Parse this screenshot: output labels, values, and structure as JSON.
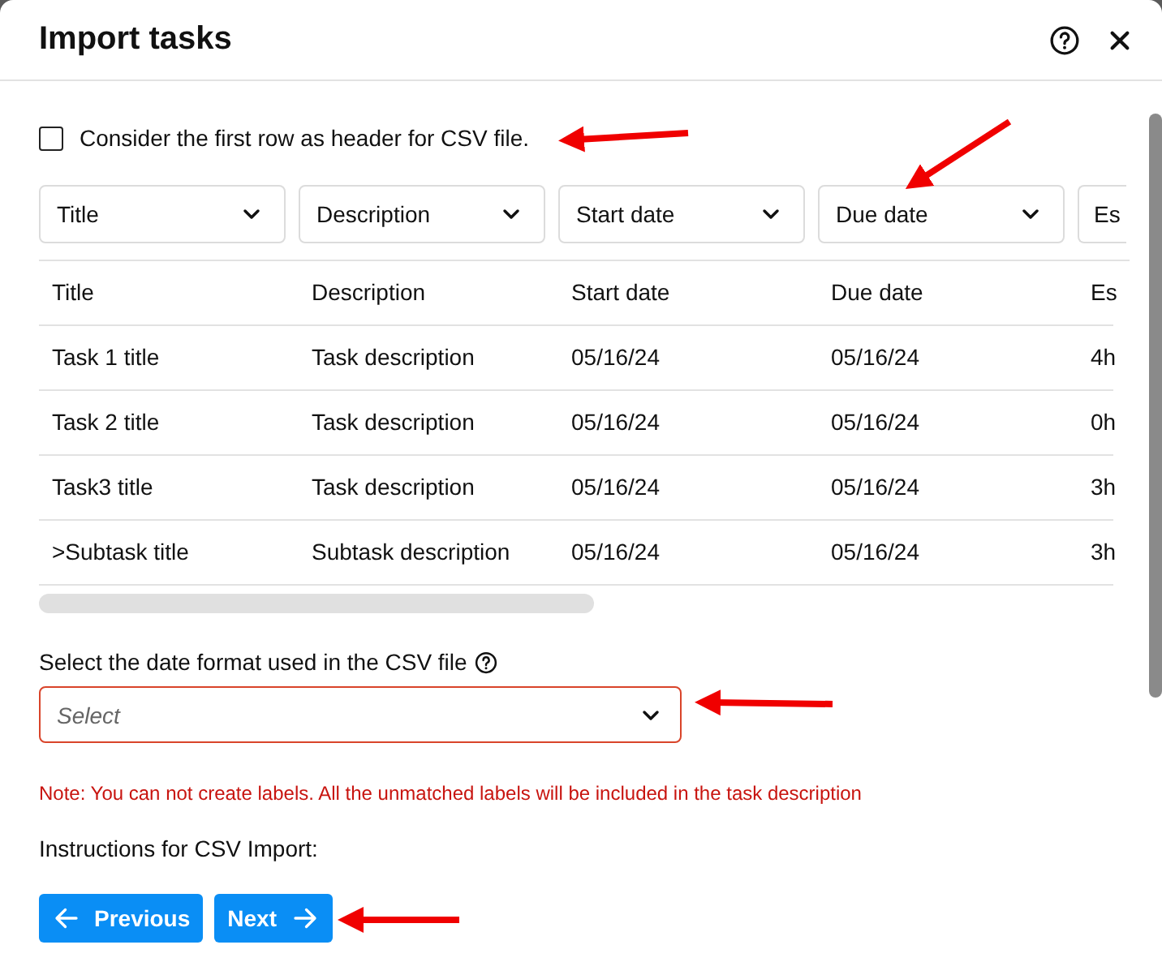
{
  "dialog": {
    "title": "Import tasks"
  },
  "header_checkbox": {
    "label": "Consider the first row as header for CSV file.",
    "checked": false
  },
  "column_mappings": [
    {
      "value": "Title"
    },
    {
      "value": "Description"
    },
    {
      "value": "Start date"
    },
    {
      "value": "Due date"
    },
    {
      "value": "Es"
    }
  ],
  "table": {
    "columns": [
      "Title",
      "Description",
      "Start date",
      "Due date",
      "Es"
    ],
    "rows": [
      [
        "Task 1 title",
        "Task description",
        "05/16/24",
        "05/16/24",
        "4h"
      ],
      [
        "Task 2 title",
        "Task description",
        "05/16/24",
        "05/16/24",
        "0h"
      ],
      [
        "Task3 title",
        "Task description",
        "05/16/24",
        "05/16/24",
        "3h"
      ],
      [
        ">Subtask title",
        "Subtask description",
        "05/16/24",
        "05/16/24",
        "3h"
      ]
    ]
  },
  "date_format": {
    "label": "Select the date format used in the CSV file",
    "placeholder": "Select",
    "error": true
  },
  "note": "Note: You can not create labels. All the unmatched labels will be included in the task description",
  "instructions_heading": "Instructions for CSV Import:",
  "buttons": [
    {
      "label": "Previous",
      "kind": "back"
    },
    {
      "label": "Next",
      "kind": "forward"
    }
  ]
}
